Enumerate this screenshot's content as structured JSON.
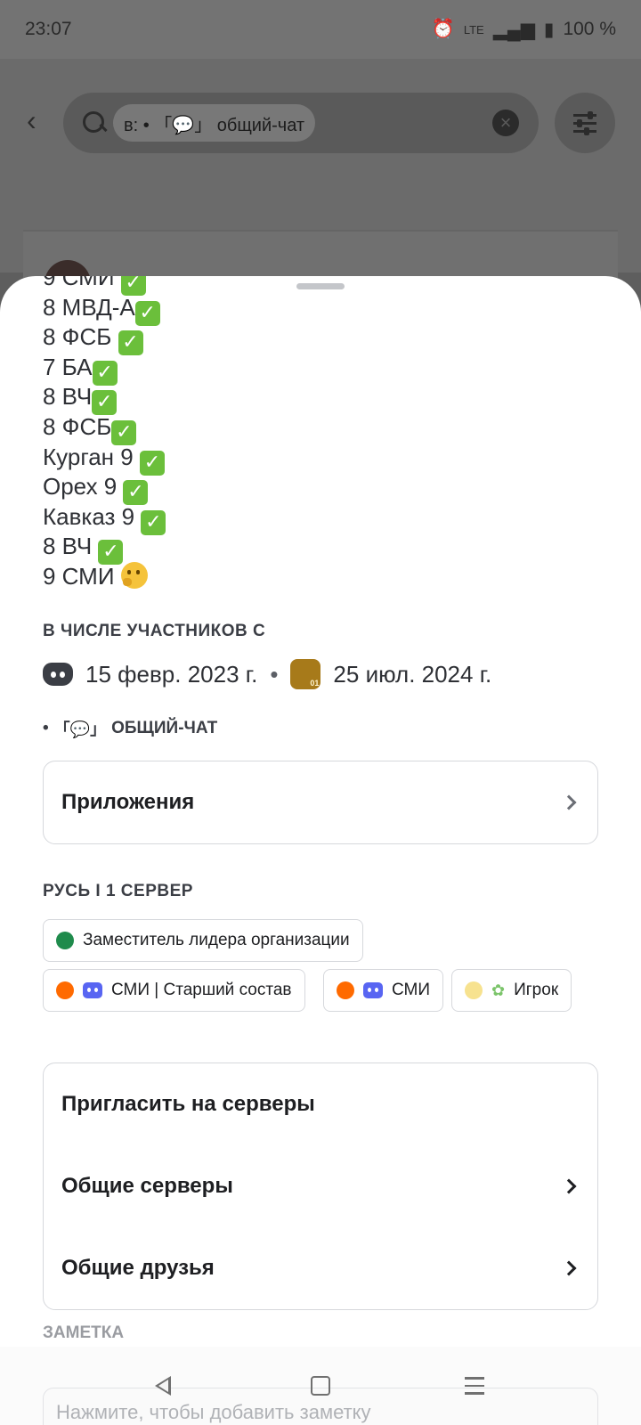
{
  "status_bar": {
    "time": "23:07",
    "network": "LTE",
    "battery": "100 %"
  },
  "search": {
    "chip_text": "в: • 「💬」 общий-чат"
  },
  "bio": {
    "lines": [
      {
        "text": "9 СМИ ",
        "mark": "check"
      },
      {
        "text": "8 МВД-А",
        "mark": "check"
      },
      {
        "text": "8 ФСБ ",
        "mark": "check"
      },
      {
        "text": "7 БА",
        "mark": "check"
      },
      {
        "text": "8 ВЧ",
        "mark": "check"
      },
      {
        "text": "8 ФСБ",
        "mark": "check"
      },
      {
        "text": "Курган 9 ",
        "mark": "check"
      },
      {
        "text": "Орех 9 ",
        "mark": "check"
      },
      {
        "text": "Кавказ 9 ",
        "mark": "check"
      },
      {
        "text": "8 ВЧ ",
        "mark": "check"
      },
      {
        "text": "9 СМИ ",
        "mark": "thinking"
      }
    ]
  },
  "member_since": {
    "title": "В ЧИСЛЕ УЧАСТНИКОВ С",
    "discord_date": "15 февр. 2023 г.",
    "separator": "•",
    "server_date": "25 июл. 2024 г.",
    "server_badge_text": "01"
  },
  "channel": {
    "bullet": "•",
    "emoji": "「💬」",
    "name": "ОБЩИЙ-ЧАТ"
  },
  "apps": {
    "label": "Приложения"
  },
  "server_roles": {
    "title": "РУСЬ I 1 СЕРВЕР",
    "roles": [
      {
        "label": "Заместитель лидера организации",
        "color": "#1f8b4c",
        "icon": ""
      },
      {
        "label": "СМИ | Старший состав",
        "color": "#ff6a00",
        "icon": "bot-icon"
      },
      {
        "label": "СМИ",
        "color": "#ff6a00",
        "icon": "bot-icon"
      },
      {
        "label": "Игрок",
        "color": "#f7e28f",
        "icon": "star-icon"
      }
    ]
  },
  "actions": {
    "invite": "Пригласить на серверы",
    "mutual_servers": "Общие серверы",
    "mutual_friends": "Общие друзья"
  },
  "note": {
    "title": "ЗАМЕТКА",
    "placeholder": "Нажмите, чтобы добавить заметку"
  }
}
